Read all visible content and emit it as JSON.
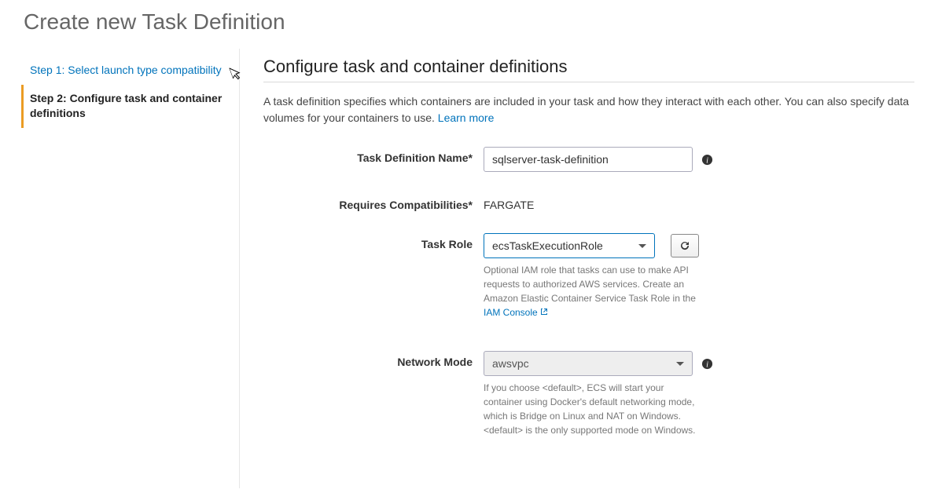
{
  "page_title": "Create new Task Definition",
  "sidebar": {
    "steps": [
      {
        "label": "Step 1: Select launch type compatibility",
        "active": false
      },
      {
        "label": "Step 2: Configure task and container definitions",
        "active": true
      }
    ]
  },
  "main": {
    "section_title": "Configure task and container definitions",
    "section_desc": "A task definition specifies which containers are included in your task and how they interact with each other. You can also specify data volumes for your containers to use. ",
    "learn_more": "Learn more",
    "fields": {
      "task_definition_name": {
        "label": "Task Definition Name*",
        "value": "sqlserver-task-definition"
      },
      "requires_compatibilities": {
        "label": "Requires Compatibilities*",
        "value": "FARGATE"
      },
      "task_role": {
        "label": "Task Role",
        "value": "ecsTaskExecutionRole",
        "help_pre": "Optional IAM role that tasks can use to make API requests to authorized AWS services. Create an Amazon Elastic Container Service Task Role in the ",
        "help_link": "IAM Console"
      },
      "network_mode": {
        "label": "Network Mode",
        "value": "awsvpc",
        "help": "If you choose <default>, ECS will start your container using Docker's default networking mode, which is Bridge on Linux and NAT on Windows. <default> is the only supported mode on Windows."
      }
    }
  }
}
